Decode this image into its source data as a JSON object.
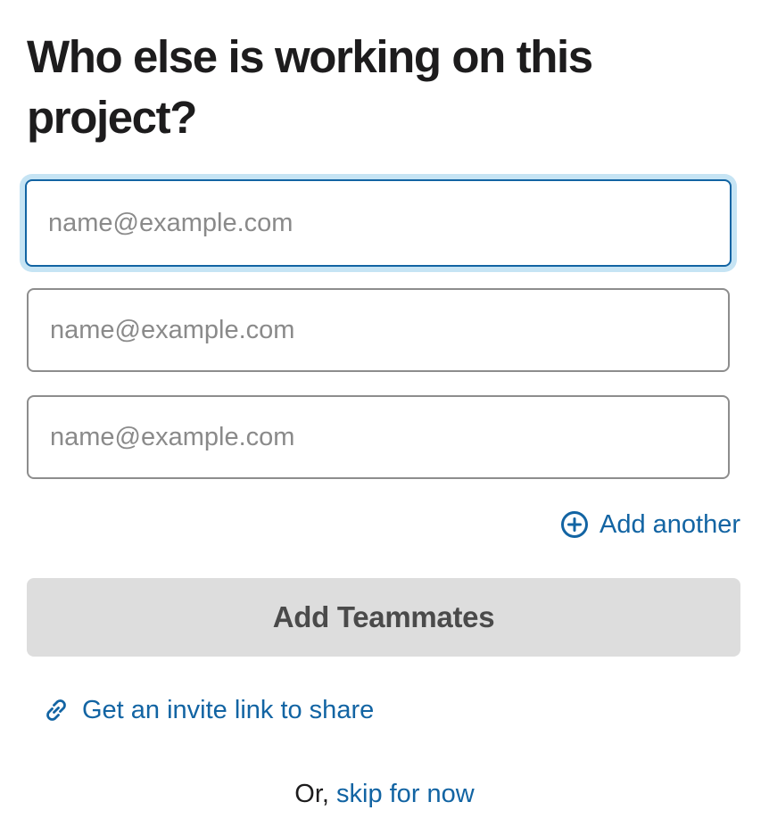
{
  "page": {
    "title": "Who else is working on this project?"
  },
  "invite_form": {
    "emails": [
      {
        "value": "",
        "placeholder": "name@example.com"
      },
      {
        "value": "",
        "placeholder": "name@example.com"
      },
      {
        "value": "",
        "placeholder": "name@example.com"
      }
    ],
    "add_another_label": "Add another",
    "add_another_icon": "plus-circle-icon",
    "submit_label": "Add Teammates",
    "submit_disabled": true,
    "invite_link_label": "Get an invite link to share",
    "invite_link_icon": "link-icon",
    "skip_prefix": "Or,",
    "skip_label": "skip for now"
  },
  "colors": {
    "link": "#1264a3",
    "focus_ring": "#c6e4f4",
    "button_disabled_bg": "#dddddd",
    "button_disabled_text": "#4a4a4a",
    "text": "#1d1c1d"
  }
}
